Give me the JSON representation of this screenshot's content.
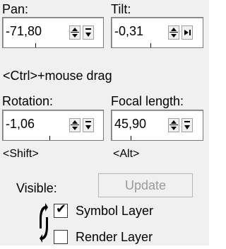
{
  "pan": {
    "label": "Pan:",
    "value": "-71,80"
  },
  "tilt": {
    "label": "Tilt:",
    "value": "-0,31"
  },
  "hint_ctrl": "<Ctrl>+mouse drag",
  "rotation": {
    "label": "Rotation:",
    "value": "-1,06"
  },
  "focal_length": {
    "label": "Focal length:",
    "value": "45,90"
  },
  "hint_shift": "<Shift>",
  "hint_alt": "<Alt>",
  "visible_label": "Visible:",
  "update_button": "Update",
  "layers": [
    {
      "label": "Symbol Layer",
      "checked": true,
      "mark": "✔"
    },
    {
      "label": "Render Layer",
      "checked": false,
      "mark": ""
    }
  ],
  "icons": [
    "spin-updown-icon",
    "dropdown-icon",
    "play-icon",
    "cycle-arrows-icon",
    "checkmark-icon"
  ]
}
